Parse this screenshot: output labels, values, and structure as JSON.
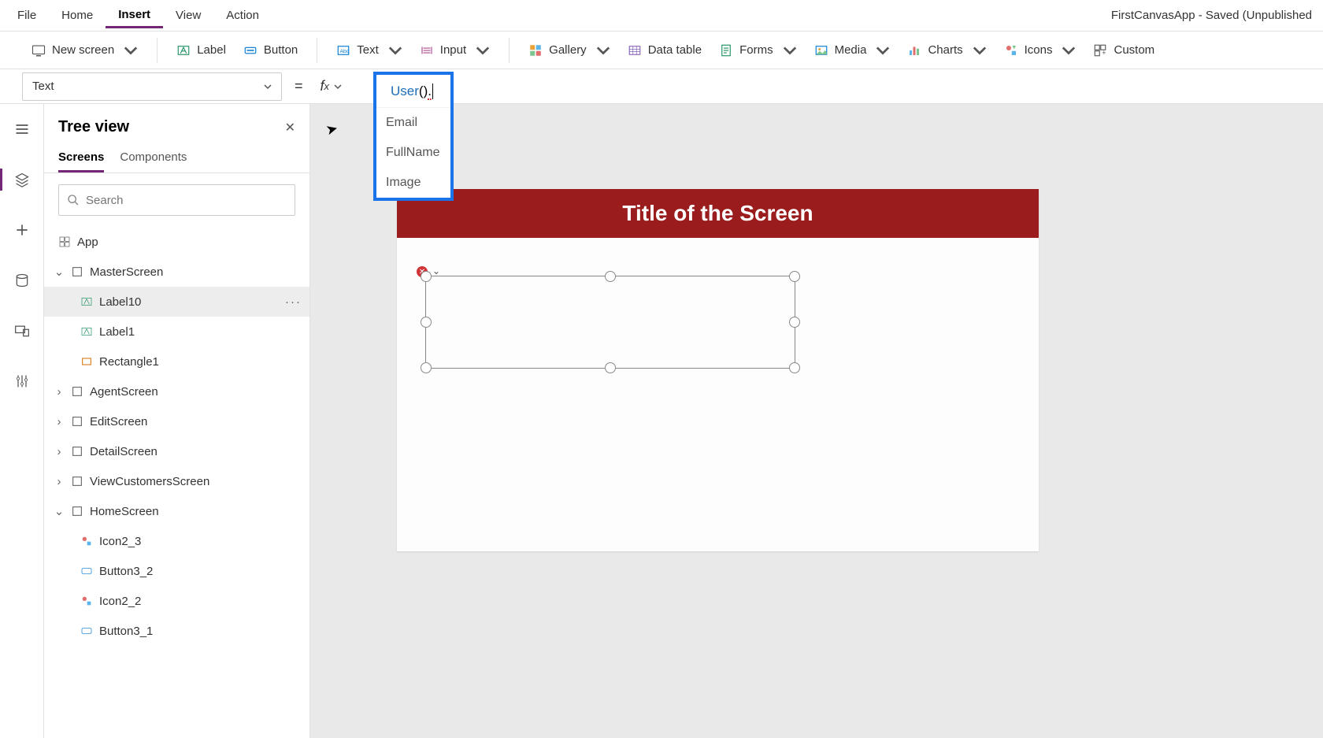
{
  "menubar": {
    "items": [
      "File",
      "Home",
      "Insert",
      "View",
      "Action"
    ],
    "active_index": 2,
    "app_title": "FirstCanvasApp - Saved (Unpublished"
  },
  "ribbon": {
    "new_screen": "New screen",
    "label": "Label",
    "button": "Button",
    "text": "Text",
    "input": "Input",
    "gallery": "Gallery",
    "data_table": "Data table",
    "forms": "Forms",
    "media": "Media",
    "charts": "Charts",
    "icons": "Icons",
    "custom": "Custom"
  },
  "formula_bar": {
    "property": "Text",
    "fn_name": "User",
    "suffix": "().",
    "autocomplete": [
      "Email",
      "FullName",
      "Image"
    ]
  },
  "tree": {
    "title": "Tree view",
    "tabs": [
      "Screens",
      "Components"
    ],
    "active_tab": 0,
    "search_placeholder": "Search",
    "app_root": "App",
    "nodes": [
      {
        "label": "MasterScreen",
        "type": "screen",
        "expanded": true,
        "children": [
          {
            "label": "Label10",
            "type": "label",
            "selected": true
          },
          {
            "label": "Label1",
            "type": "label"
          },
          {
            "label": "Rectangle1",
            "type": "rect"
          }
        ]
      },
      {
        "label": "AgentScreen",
        "type": "screen",
        "expanded": false
      },
      {
        "label": "EditScreen",
        "type": "screen",
        "expanded": false
      },
      {
        "label": "DetailScreen",
        "type": "screen",
        "expanded": false
      },
      {
        "label": "ViewCustomersScreen",
        "type": "screen",
        "expanded": false
      },
      {
        "label": "HomeScreen",
        "type": "screen",
        "expanded": true,
        "children": [
          {
            "label": "Icon2_3",
            "type": "icon"
          },
          {
            "label": "Button3_2",
            "type": "button"
          },
          {
            "label": "Icon2_2",
            "type": "icon"
          },
          {
            "label": "Button3_1",
            "type": "button"
          }
        ]
      }
    ]
  },
  "canvas": {
    "screen_title": "Title of the Screen"
  }
}
